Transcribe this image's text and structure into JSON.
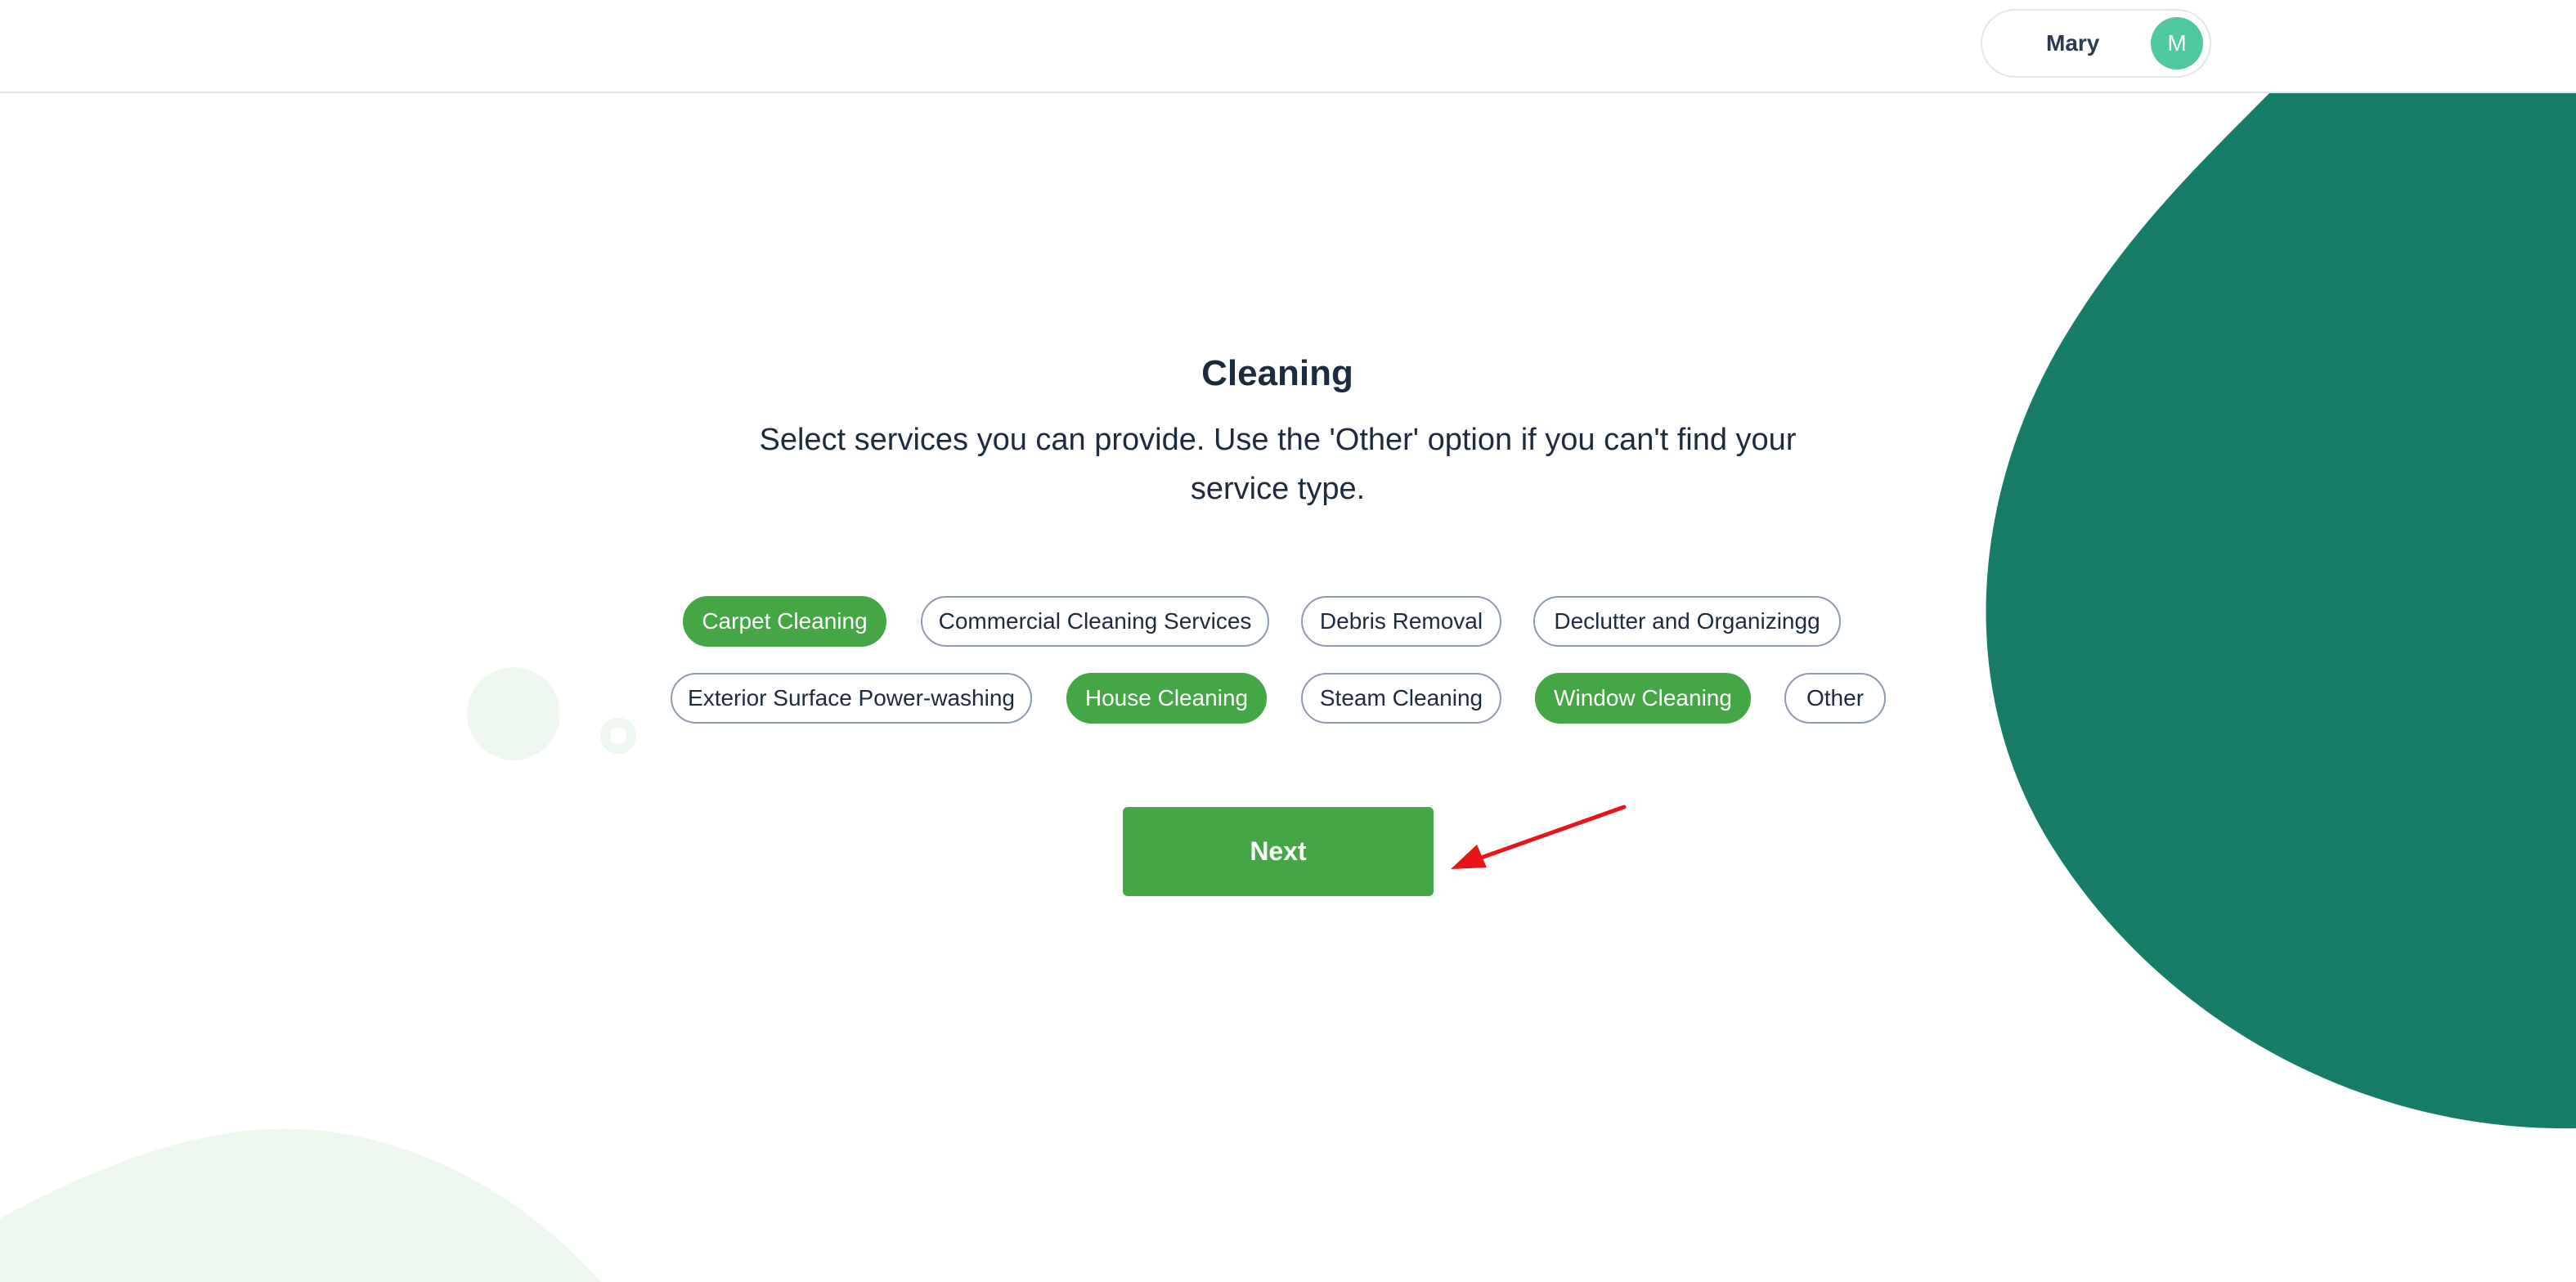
{
  "header": {
    "user_name": "Mary",
    "avatar_initial": "M"
  },
  "main": {
    "title": "Cleaning",
    "subtitle": "Select services you can provide. Use the 'Other' option if you can't find your service type.",
    "services": [
      {
        "label": "Carpet Cleaning",
        "selected": true
      },
      {
        "label": "Commercial Cleaning Services",
        "selected": false
      },
      {
        "label": "Debris Removal",
        "selected": false
      },
      {
        "label": "Declutter and Organizingg",
        "selected": false
      },
      {
        "label": "Exterior Surface Power-washing",
        "selected": false
      },
      {
        "label": "House Cleaning",
        "selected": true
      },
      {
        "label": "Steam Cleaning",
        "selected": false
      },
      {
        "label": "Window Cleaning",
        "selected": true
      },
      {
        "label": "Other",
        "selected": false
      }
    ],
    "next_label": "Next"
  },
  "colors": {
    "brand_green": "#44a645",
    "dark_teal": "#177d68",
    "avatar_teal": "#4fc8a0",
    "text_dark": "#1d2b3f",
    "chip_border": "#8a9ab0",
    "pale_green": "#eef7ee",
    "annotation_red": "#e8141b"
  }
}
